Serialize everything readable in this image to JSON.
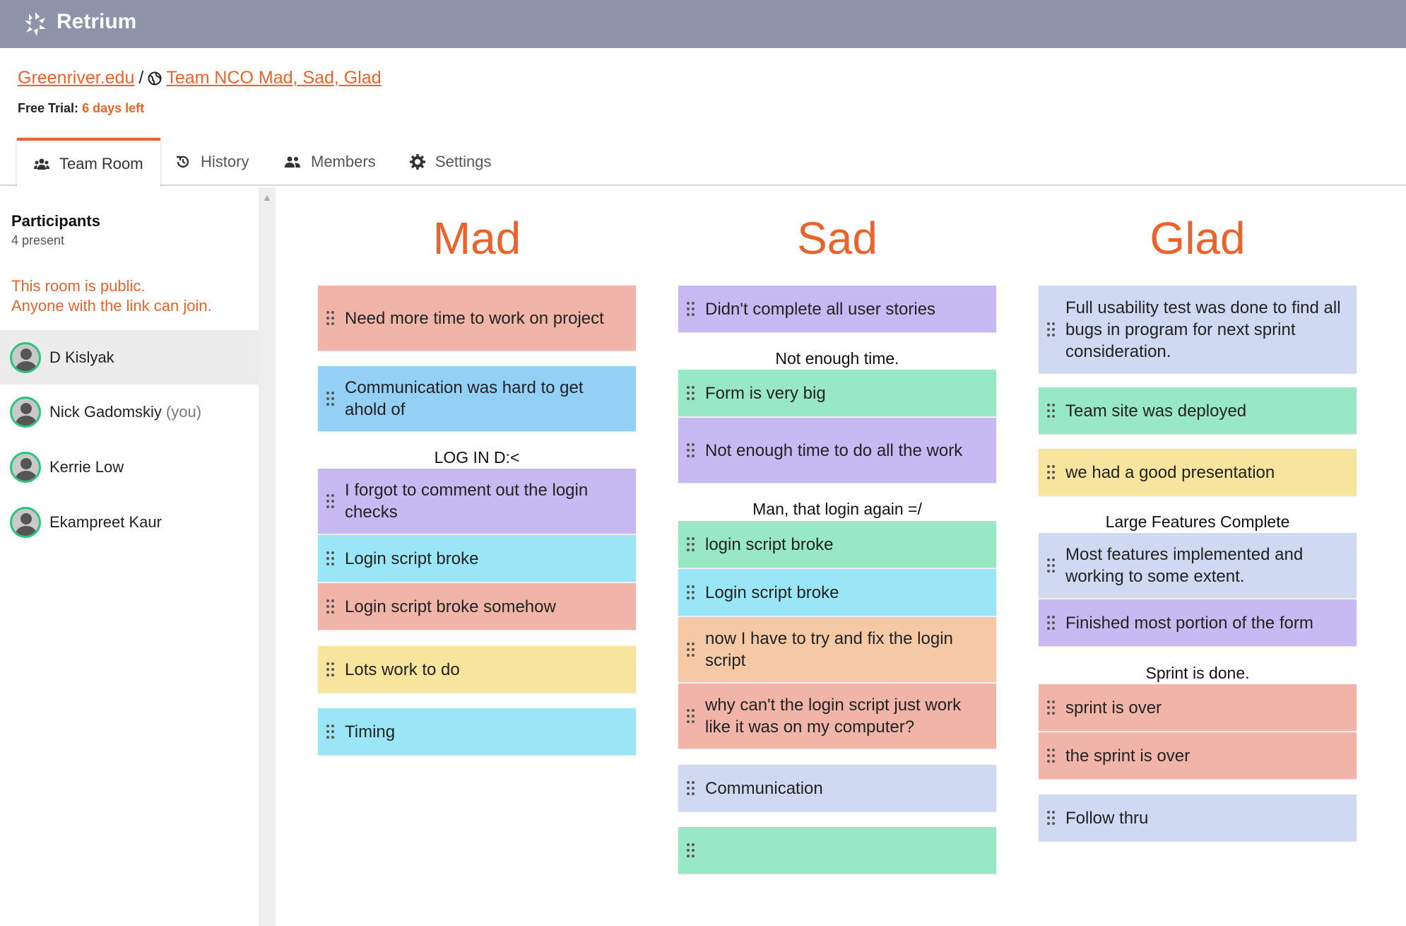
{
  "app": {
    "name": "Retrium"
  },
  "breadcrumb": {
    "org": "Greenriver.edu",
    "separator": "/",
    "room": "Team NCO Mad, Sad, Glad"
  },
  "trial": {
    "label": "Free Trial:",
    "days": "6 days left"
  },
  "tabs": [
    {
      "label": "Team Room",
      "icon": "team-icon"
    },
    {
      "label": "History",
      "icon": "history-icon"
    },
    {
      "label": "Members",
      "icon": "members-icon"
    },
    {
      "label": "Settings",
      "icon": "gear-icon"
    }
  ],
  "sidebar": {
    "title": "Participants",
    "count": "4 present",
    "notice_line1": "This room is public.",
    "notice_line2": "Anyone with the link can join.",
    "participants": [
      {
        "name": "D Kislyak",
        "suffix": ""
      },
      {
        "name": "Nick Gadomskiy",
        "suffix": "(you)"
      },
      {
        "name": "Kerrie Low",
        "suffix": ""
      },
      {
        "name": "Ekampreet Kaur",
        "suffix": ""
      }
    ]
  },
  "columns": [
    {
      "title": "Mad",
      "cards": [
        {
          "text": "Need more time to work on project",
          "color": "#f0b4a8"
        },
        {
          "text": "Communication was hard to get ahold of",
          "color": "#94cff5"
        },
        {
          "text": "I forgot to comment out the login checks",
          "color": "#c7b9f2"
        },
        {
          "text": "Login script broke",
          "color": "#9ae6f6"
        },
        {
          "text": "Login script broke somehow",
          "color": "#f0b4a8"
        },
        {
          "text": "Lots work to do",
          "color": "#f7e49d"
        },
        {
          "text": "Timing",
          "color": "#9ae6f6"
        }
      ],
      "groups": [
        "LOG IN D:<"
      ]
    },
    {
      "title": "Sad",
      "cards": [
        {
          "text": "Didn't complete all user stories",
          "color": "#c7b9f2"
        },
        {
          "text": "Form is very big",
          "color": "#99e8c5"
        },
        {
          "text": "Not enough time to do all the work",
          "color": "#c7b9f2"
        },
        {
          "text": "login script broke",
          "color": "#99e8c5"
        },
        {
          "text": "Login script broke",
          "color": "#9ae6f6"
        },
        {
          "text": "now I have to try and fix the login script",
          "color": "#f6c9a6"
        },
        {
          "text": "why can't the login script just work like it was on my computer?",
          "color": "#f0b4a8"
        },
        {
          "text": "Communication",
          "color": "#cfd9f1"
        },
        {
          "text": "",
          "color": "#99e8c5"
        }
      ],
      "groups": [
        "Not enough time.",
        "Man, that login again =/"
      ]
    },
    {
      "title": "Glad",
      "cards": [
        {
          "text": "Full usability test was done to find all bugs in program for next sprint consideration.",
          "color": "#cfd9f1"
        },
        {
          "text": "Team site was deployed",
          "color": "#99e8c5"
        },
        {
          "text": "we had a good presentation",
          "color": "#f7e49d"
        },
        {
          "text": "Most features implemented and working to some extent.",
          "color": "#cfd9f1"
        },
        {
          "text": "Finished most portion of the form",
          "color": "#c7b9f2"
        },
        {
          "text": "sprint is over",
          "color": "#f0b4a8"
        },
        {
          "text": "the sprint is over",
          "color": "#f0b4a8"
        },
        {
          "text": "Follow thru",
          "color": "#cfd9f1"
        }
      ],
      "groups": [
        "Large Features Complete",
        "Sprint is done."
      ]
    }
  ]
}
